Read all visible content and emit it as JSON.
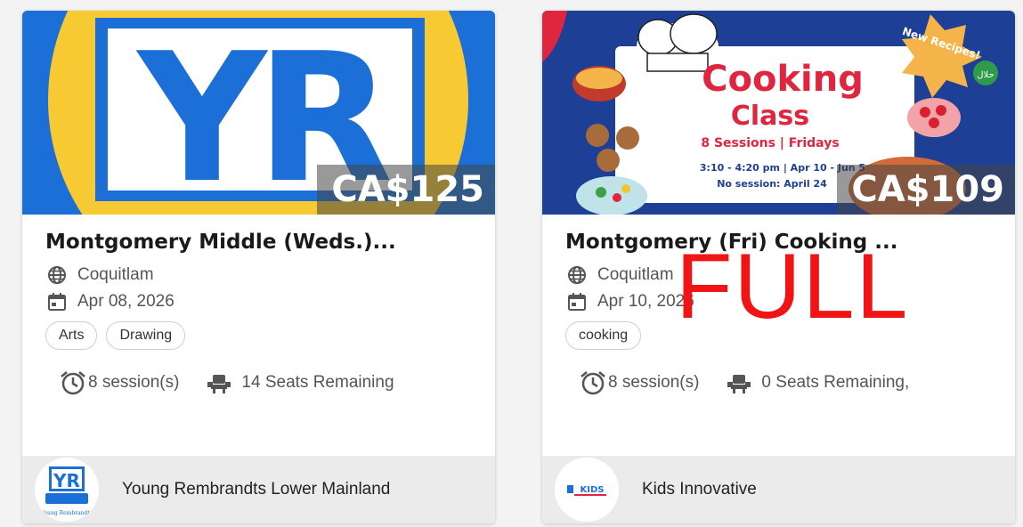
{
  "cards": [
    {
      "price": "CA$125",
      "title": "Montgomery Middle (Weds.)...",
      "location": "Coquitlam",
      "date": "Apr 08, 2026",
      "tags": [
        "Arts",
        "Drawing"
      ],
      "sessions": "8 session(s)",
      "seats": "14 Seats Remaining",
      "organization": "Young Rembrandts Lower Mainland",
      "hero_text": "YR",
      "logo_text": "YR",
      "logo_subtext": "Young Rembrandts"
    },
    {
      "price": "CA$109",
      "title": "Montgomery (Fri) Cooking ...",
      "location": "Coquitlam",
      "date": "Apr 10, 2026",
      "tags": [
        "cooking"
      ],
      "sessions": "8 session(s)",
      "seats": "0 Seats Remaining,",
      "organization": "Kids Innovative",
      "status_stamp": "FULL",
      "hero_heading_1": "Cooking",
      "hero_heading_2": "Class",
      "hero_line_1": "8 Sessions | Fridays",
      "hero_line_2": "3:10 - 4:20 pm | Apr 10 - Jun 5",
      "hero_line_3": "No session: April 24",
      "hero_badge": "New Recipes!",
      "hero_halal": "حلال",
      "logo_text": "KIDS"
    }
  ],
  "colors": {
    "yr_blue": "#1b6fd6",
    "yr_yellow": "#f7c932",
    "cooking_blue": "#1e3f96",
    "cooking_red": "#e0263f",
    "full_red": "#f01414"
  },
  "icons": {
    "location": "globe-icon",
    "date": "calendar-icon",
    "sessions": "alarm-clock-icon",
    "seats": "seat-icon"
  }
}
